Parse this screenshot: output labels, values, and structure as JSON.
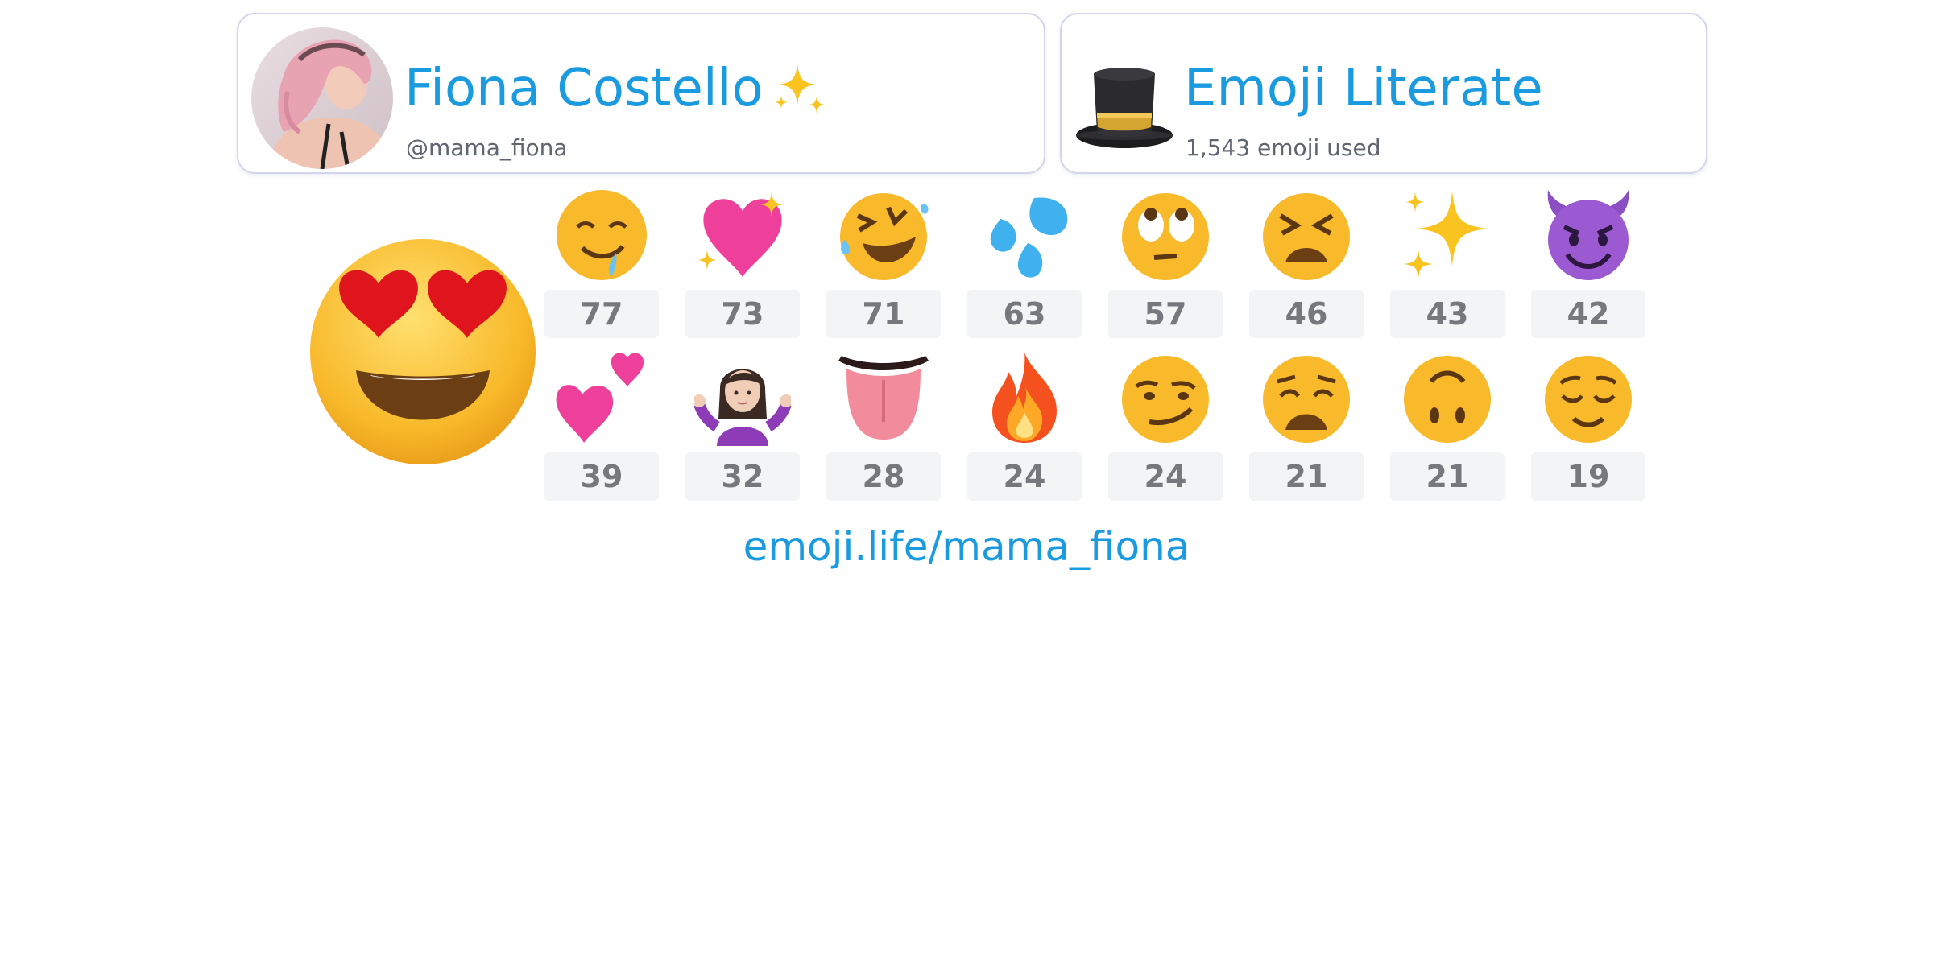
{
  "profile": {
    "name": "Fiona Costello",
    "handle": "@mama_fiona",
    "name_icon": "sparkles-icon",
    "avatar": "avatar-photo"
  },
  "badge": {
    "title": "Emoji Literate",
    "subtitle": "1,543 emoji used",
    "icon": "top-hat-icon"
  },
  "top_emoji": {
    "icon": "smiling-face-with-heart-eyes-icon"
  },
  "emoji_counts": [
    {
      "icon": "drooling-face-icon",
      "count": "77"
    },
    {
      "icon": "sparkling-heart-icon",
      "count": "73"
    },
    {
      "icon": "rolling-on-the-floor-laughing-icon",
      "count": "71"
    },
    {
      "icon": "sweat-droplets-icon",
      "count": "63"
    },
    {
      "icon": "face-with-rolling-eyes-icon",
      "count": "57"
    },
    {
      "icon": "tired-face-icon",
      "count": "46"
    },
    {
      "icon": "sparkles-icon",
      "count": "43"
    },
    {
      "icon": "smiling-face-with-horns-icon",
      "count": "42"
    },
    {
      "icon": "two-hearts-icon",
      "count": "39"
    },
    {
      "icon": "woman-shrugging-icon",
      "count": "32"
    },
    {
      "icon": "tongue-icon",
      "count": "28"
    },
    {
      "icon": "fire-icon",
      "count": "24"
    },
    {
      "icon": "smirking-face-icon",
      "count": "24"
    },
    {
      "icon": "weary-face-icon",
      "count": "21"
    },
    {
      "icon": "upside-down-face-icon",
      "count": "21"
    },
    {
      "icon": "relieved-face-icon",
      "count": "19"
    }
  ],
  "link": {
    "url_text": "emoji.life/mama_fiona"
  },
  "colors": {
    "accent": "#1a9be0",
    "emoji_yellow": "#f7b92d",
    "card_border": "#d3d6ea",
    "count_bg": "#f3f4f6",
    "count_text": "#76787d"
  }
}
